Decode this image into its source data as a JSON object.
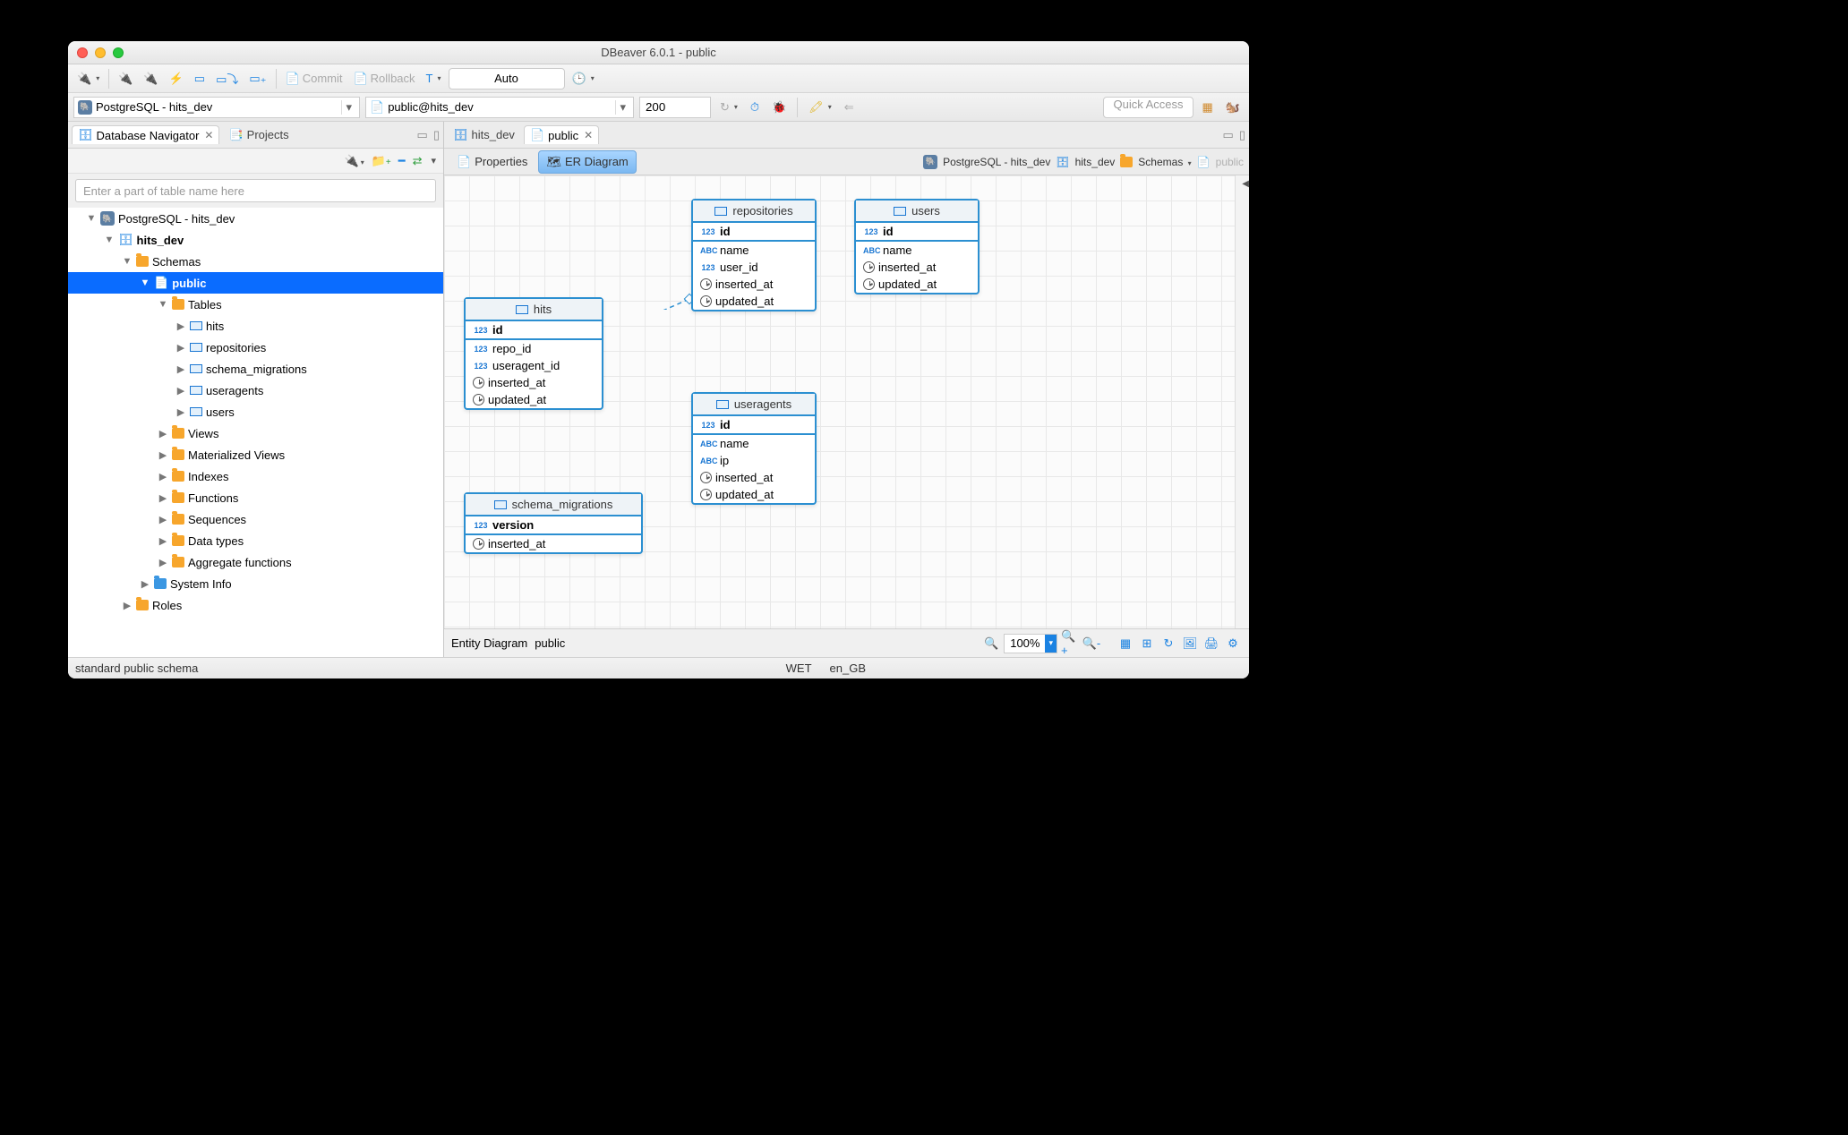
{
  "window_title": "DBeaver 6.0.1 - public",
  "toolbar": {
    "commit": "Commit",
    "rollback": "Rollback",
    "auto": "Auto"
  },
  "toolbar2": {
    "conn": "PostgreSQL - hits_dev",
    "schema": "public@hits_dev",
    "limit": "200",
    "quick_access": "Quick Access"
  },
  "left": {
    "tab_navigator": "Database Navigator",
    "tab_projects": "Projects",
    "filter_placeholder": "Enter a part of table name here",
    "tree": {
      "root": "PostgreSQL - hits_dev",
      "db": "hits_dev",
      "schemas": "Schemas",
      "public": "public",
      "tables": "Tables",
      "table_list": [
        "hits",
        "repositories",
        "schema_migrations",
        "useragents",
        "users"
      ],
      "views": "Views",
      "mat_views": "Materialized Views",
      "indexes": "Indexes",
      "functions": "Functions",
      "sequences": "Sequences",
      "data_types": "Data types",
      "agg_funcs": "Aggregate functions",
      "system_info": "System Info",
      "roles": "Roles"
    }
  },
  "editor": {
    "tab_db": "hits_dev",
    "tab_schema": "public",
    "subtab_props": "Properties",
    "subtab_er": "ER Diagram",
    "crumb_conn": "PostgreSQL - hits_dev",
    "crumb_db": "hits_dev",
    "crumb_schemas": "Schemas",
    "crumb_public": "public"
  },
  "entities": {
    "hits": {
      "name": "hits",
      "cols": [
        "id",
        "repo_id",
        "useragent_id",
        "inserted_at",
        "updated_at"
      ]
    },
    "repositories": {
      "name": "repositories",
      "cols": [
        "id",
        "name",
        "user_id",
        "inserted_at",
        "updated_at"
      ]
    },
    "users": {
      "name": "users",
      "cols": [
        "id",
        "name",
        "inserted_at",
        "updated_at"
      ]
    },
    "useragents": {
      "name": "useragents",
      "cols": [
        "id",
        "name",
        "ip",
        "inserted_at",
        "updated_at"
      ]
    },
    "schema_migrations": {
      "name": "schema_migrations",
      "cols": [
        "version",
        "inserted_at"
      ]
    }
  },
  "canvas_footer": {
    "label": "Entity Diagram",
    "schema": "public",
    "zoom": "100%"
  },
  "status": {
    "left": "standard public schema",
    "tz": "WET",
    "locale": "en_GB"
  }
}
